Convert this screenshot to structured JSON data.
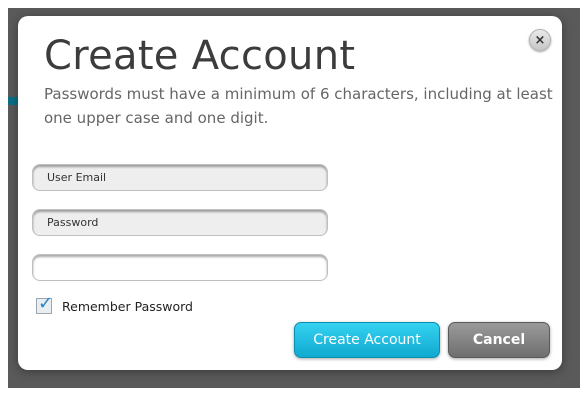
{
  "modal": {
    "title": "Create Account",
    "subtitle": "Passwords must have a minimum of 6 characters, including at least one upper case and one digit.",
    "close_icon": "×"
  },
  "fields": {
    "email_label": "User Email",
    "password_label": "Password",
    "confirm_value": ""
  },
  "remember": {
    "label": "Remember Password",
    "checked": true
  },
  "buttons": {
    "create_label": "Create Account",
    "cancel_label": "Cancel"
  },
  "colors": {
    "primary": "#10a9d0",
    "secondary": "#6f6f6f",
    "backdrop": "#5a5a5a"
  },
  "icons": {
    "close": "close-icon",
    "check": "checkmark-icon"
  }
}
